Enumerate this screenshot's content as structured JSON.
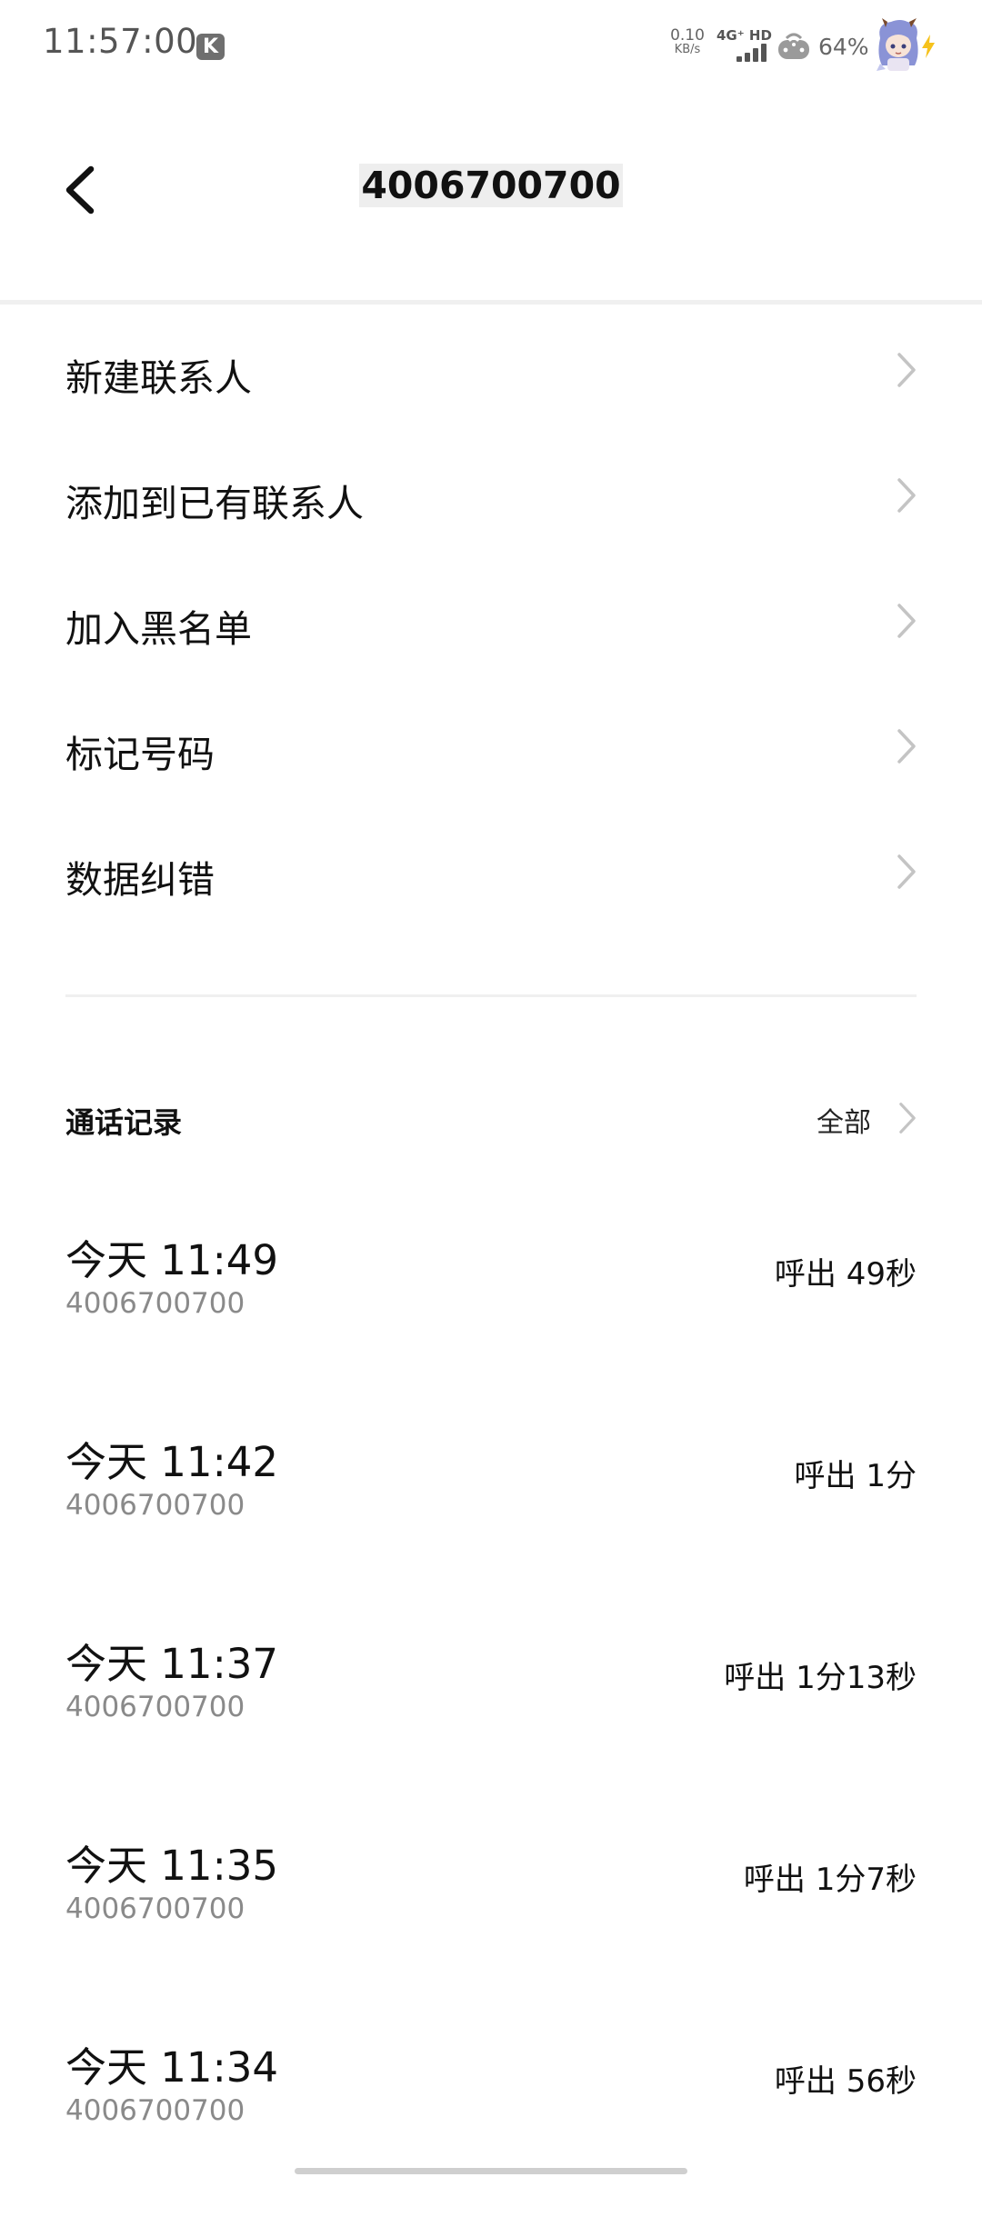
{
  "status_bar": {
    "time": "11:57:00",
    "k_icon": "K",
    "net_speed_value": "0.10",
    "net_speed_unit": "KB/s",
    "signal_label": "4G⁺ HD",
    "battery": "64%"
  },
  "header": {
    "back_icon": "chevron-left-icon",
    "title": "4006700700"
  },
  "menu": {
    "items": [
      {
        "label": "新建联系人"
      },
      {
        "label": "添加到已有联系人"
      },
      {
        "label": "加入黑名单"
      },
      {
        "label": "标记号码"
      },
      {
        "label": "数据纠错"
      }
    ]
  },
  "call_log": {
    "title": "通话记录",
    "all_label": "全部",
    "entries": [
      {
        "time": "今天 11:49",
        "number": "4006700700",
        "status": "呼出 49秒"
      },
      {
        "time": "今天 11:42",
        "number": "4006700700",
        "status": "呼出 1分"
      },
      {
        "time": "今天 11:37",
        "number": "4006700700",
        "status": "呼出 1分13秒"
      },
      {
        "time": "今天 11:35",
        "number": "4006700700",
        "status": "呼出 1分7秒"
      },
      {
        "time": "今天 11:34",
        "number": "4006700700",
        "status": "呼出 56秒"
      }
    ]
  },
  "colors": {
    "text_primary": "#111111",
    "text_secondary": "#8a8a8a",
    "chevron": "#c4c4c4",
    "divider": "#f0f0f0"
  }
}
